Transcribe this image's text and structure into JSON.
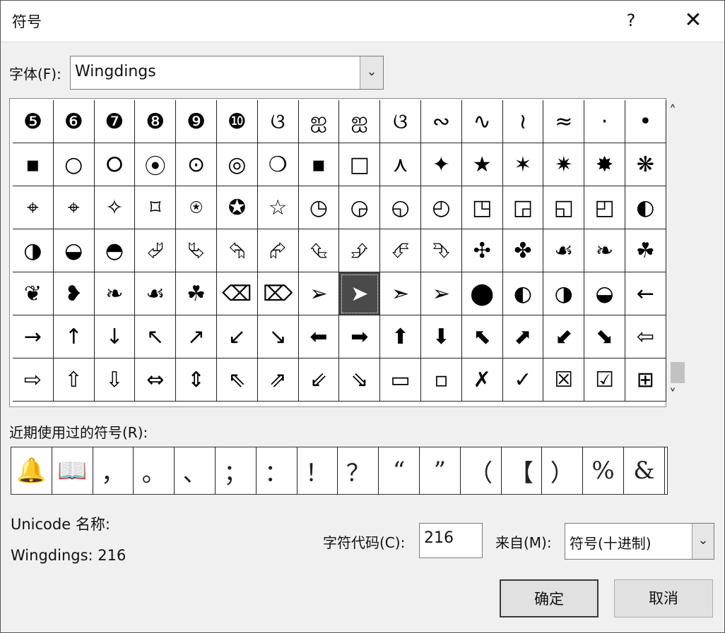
{
  "dialog": {
    "title": "符号",
    "help_label": "?",
    "close_label": "✕"
  },
  "font": {
    "label": "字体(F):",
    "value": "Wingdings",
    "dropdown_glyph": "⌄"
  },
  "grid": {
    "selected_index": 72,
    "glyphs": [
      "❺",
      "❻",
      "❼",
      "❽",
      "❾",
      "❿",
      "ଓ",
      "ஐ",
      "ஐ",
      "ଓ",
      "∾",
      "∿",
      "≀",
      "≈",
      "·",
      "•",
      "▪",
      "○",
      "⭘",
      "⦿",
      "⊙",
      "◎",
      "❍",
      "▪",
      "□",
      "⋏",
      "✦",
      "★",
      "✶",
      "✷",
      "✸",
      "❋",
      "⌖",
      "⌖",
      "✧",
      "⌑",
      "⍟",
      "✪",
      "☆",
      "◷",
      "◶",
      "◵",
      "◴",
      "◳",
      "◲",
      "◱",
      "◰",
      "◐",
      "◑",
      "◒",
      "◓",
      "⮰",
      "⮱",
      "⮲",
      "⮳",
      "⮴",
      "⮵",
      "⮶",
      "⮷",
      "✣",
      "✤",
      "☙",
      "❧",
      "☘",
      "❦",
      "❥",
      "❧",
      "☙",
      "☘",
      "⌫",
      "⌦",
      "➢",
      "➤",
      "➣",
      "➢",
      "⬤",
      "◐",
      "◑",
      "◒",
      "←",
      "→",
      "↑",
      "↓",
      "↖",
      "↗",
      "↙",
      "↘",
      "⬅",
      "➡",
      "⬆",
      "⬇",
      "⬉",
      "⬈",
      "⬋",
      "⬊",
      "⇦",
      "⇨",
      "⇧",
      "⇩",
      "⇔",
      "⇕",
      "⇖",
      "⇗",
      "⇙",
      "⇘",
      "▭",
      "▫",
      "✗",
      "✓",
      "☒",
      "☑",
      "⊞"
    ]
  },
  "scrollbar": {
    "up_glyph": "˄",
    "down_glyph": "˅"
  },
  "recent": {
    "label": "近期使用过的符号(R):",
    "glyphs": [
      "🔔",
      "📖",
      "，",
      "。",
      "、",
      "；",
      "：",
      "！",
      "？",
      "“",
      "”",
      "（",
      "【",
      "）",
      "%",
      "&"
    ]
  },
  "unicode": {
    "name_label": "Unicode 名称:",
    "name_value": "Wingdings: 216"
  },
  "char_code": {
    "label": "字符代码(C):",
    "value": "216"
  },
  "from": {
    "label": "来自(M):",
    "value": "符号(十进制)",
    "dropdown_glyph": "⌄"
  },
  "buttons": {
    "ok": "确定",
    "cancel": "取消"
  }
}
